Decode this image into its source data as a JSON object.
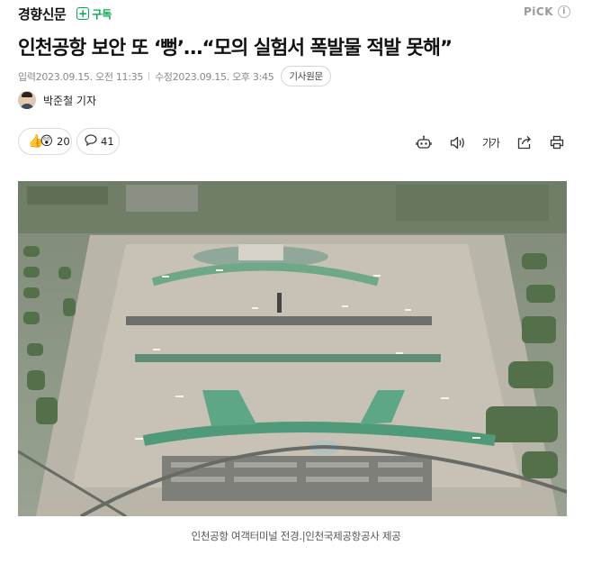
{
  "header": {
    "press_name": "경향신문",
    "subscribe_label": "구독",
    "pick_label": "PiCK",
    "info_glyph": "i"
  },
  "article": {
    "title": "인천공항 보안 또 ‘뻥’…“모의 실험서 폭발물 적발 못해”",
    "input_label": "입력",
    "input_date": "2023.09.15. 오전 11:35",
    "modified_label": "수정",
    "modified_date": "2023.09.15. 오후 3:45",
    "original_button": "기사원문",
    "reporter": "박준철 기자"
  },
  "reactions": {
    "reaction_count": "20",
    "comment_count": "41"
  },
  "toolbar": {
    "icons": [
      "robot-summary-icon",
      "speaker-icon",
      "font-size-icon",
      "share-icon",
      "print-icon"
    ],
    "font_size_label": "가가"
  },
  "figure": {
    "caption": "인천공항 여객터미널 전경.|인천국제공항공사 제공"
  },
  "colors": {
    "subscribe_green": "#03a94f",
    "meta_gray": "#888888",
    "border_gray": "#dadada"
  }
}
